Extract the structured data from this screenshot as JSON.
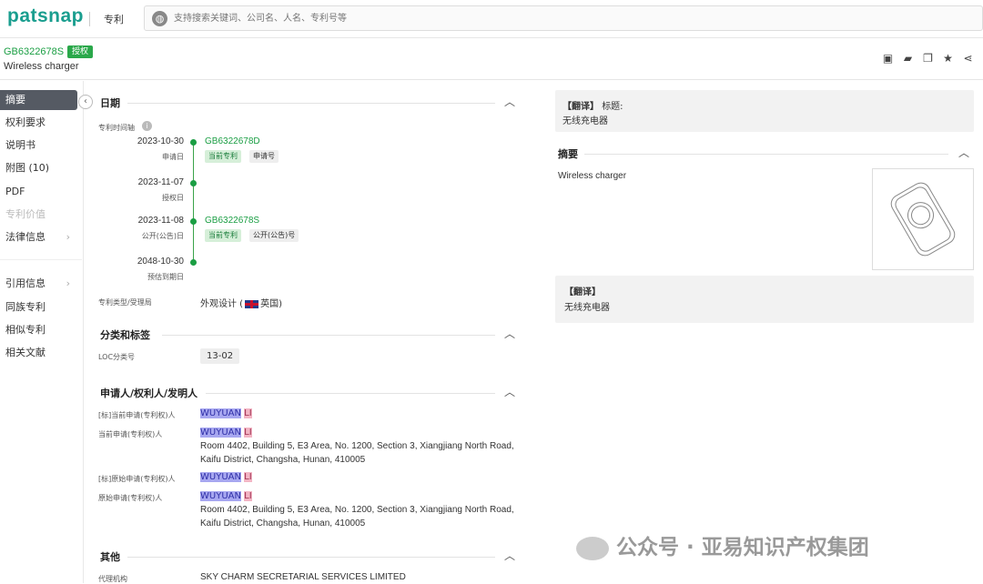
{
  "top": {
    "logo": "patsnap",
    "module": "专利",
    "search_placeholder": "支持搜索关键词、公司名、人名、专利号等"
  },
  "patent": {
    "number": "GB6322678S",
    "status_badge": "授权",
    "title": "Wireless charger"
  },
  "sidebar": {
    "items": [
      {
        "label": "摘要",
        "active": true
      },
      {
        "label": "权利要求"
      },
      {
        "label": "说明书"
      },
      {
        "label": "附图 (10)"
      },
      {
        "label": "PDF"
      },
      {
        "label": "专利价值",
        "disabled": true
      },
      {
        "label": "法律信息",
        "arrow": "›"
      },
      {
        "label": "引用信息",
        "arrow": "›"
      },
      {
        "label": "同族专利"
      },
      {
        "label": "相似专利"
      },
      {
        "label": "相关文献"
      }
    ]
  },
  "dates": {
    "section": "日期",
    "timeline_label": "专利时间轴",
    "events": [
      {
        "date": "2023-10-30",
        "label": "申请日",
        "number": "GB6322678D",
        "tags": [
          "当前专利",
          "申请号"
        ]
      },
      {
        "date": "2023-11-07",
        "label": "授权日"
      },
      {
        "date": "2023-11-08",
        "label": "公开(公告)日",
        "number": "GB6322678S",
        "tags": [
          "当前专利",
          "公开(公告)号"
        ]
      },
      {
        "date": "2048-10-30",
        "label": "预估到期日"
      }
    ],
    "type_label": "专利类型/受理局",
    "type_value": "外观设计 (",
    "office": "英国)"
  },
  "classification": {
    "section": "分类和标签",
    "loc_label": "LOC分类号",
    "loc_value": "13-02"
  },
  "applicants": {
    "section": "申请人/权利人/发明人",
    "rows": [
      {
        "label": "[标]当前申请(专利权)人",
        "name_a": "WUYUAN",
        "name_b": "LI"
      },
      {
        "label": "当前申请(专利权)人",
        "name_a": "WUYUAN",
        "name_b": "LI",
        "addr1": "Room 4402, Building 5, E3 Area, No. 1200, Section 3, Xiangjiang North Road,",
        "addr2": "Kaifu District, Changsha, Hunan, 410005"
      },
      {
        "label": "[标]原始申请(专利权)人",
        "name_a": "WUYUAN",
        "name_b": "LI"
      },
      {
        "label": "原始申请(专利权)人",
        "name_a": "WUYUAN",
        "name_b": "LI",
        "addr1": "Room 4402, Building 5, E3 Area, No. 1200, Section 3, Xiangjiang North Road,",
        "addr2": "Kaifu District, Changsha, Hunan, 410005"
      }
    ]
  },
  "other": {
    "section": "其他",
    "agent_label": "代理机构",
    "agent_value": "SKY CHARM SECRETARIAL SERVICES LIMITED"
  },
  "right": {
    "translate_tag": "【翻译】",
    "title_label": "标题:",
    "title_cn": "无线充电器",
    "abstract_section": "摘要",
    "abstract_text": "Wireless charger",
    "translate_tag2": "【翻译】",
    "abstract_cn": "无线充电器"
  },
  "watermark": "公众号 · 亚易知识产权集团"
}
